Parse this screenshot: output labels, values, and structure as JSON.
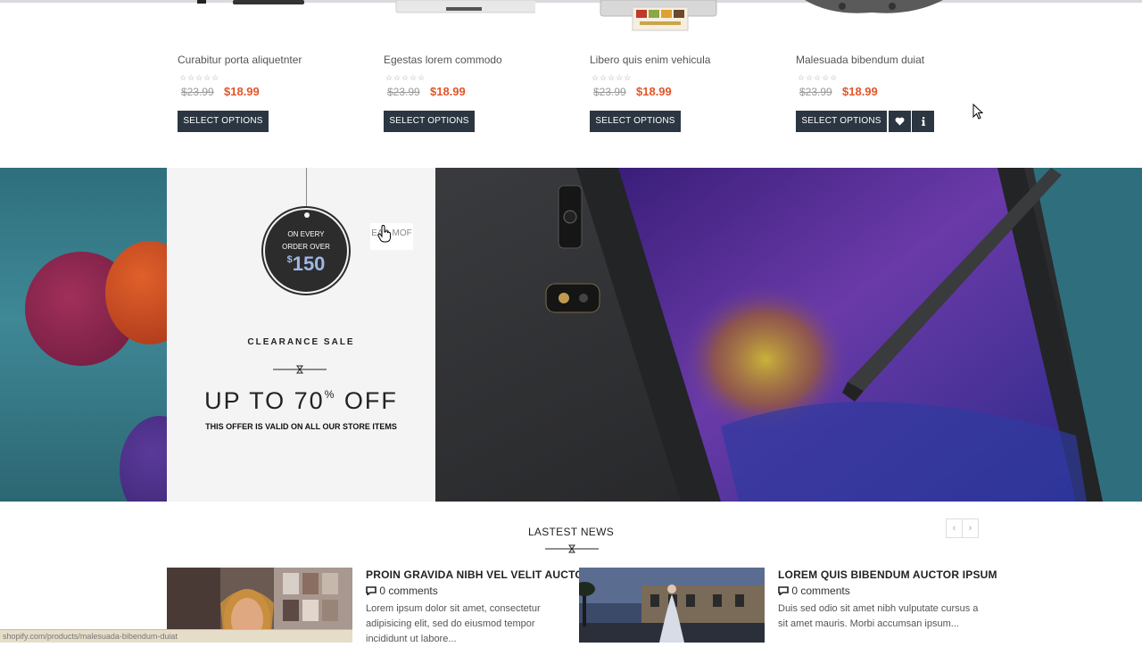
{
  "products": [
    {
      "name": "Curabitur porta aliquetnter",
      "stars": "☆☆☆☆☆",
      "old_price": "$23.99",
      "price": "$18.99",
      "button": "SELECT OPTIONS"
    },
    {
      "name": "Egestas lorem commodo",
      "stars": "☆☆☆☆☆",
      "old_price": "$23.99",
      "price": "$18.99",
      "button": "SELECT OPTIONS"
    },
    {
      "name": "Libero quis enim vehicula",
      "stars": "☆☆☆☆☆",
      "old_price": "$23.99",
      "price": "$18.99",
      "button": "SELECT OPTIONS"
    },
    {
      "name": "Malesuada bibendum duiat",
      "stars": "☆☆☆☆☆",
      "old_price": "$23.99",
      "price": "$18.99",
      "button": "SELECT OPTIONS",
      "wishlist_icon": "heart-icon",
      "info_icon": "info-icon"
    }
  ],
  "banner": {
    "tag_line1": "ON EVERY",
    "tag_line2": "ORDER OVER",
    "tag_currency": "$",
    "tag_amount": "150",
    "read_more": "EAD MOF",
    "clearance": "CLEARANCE SALE",
    "upto_prefix": "UP TO 70",
    "upto_percent": "%",
    "upto_suffix": " OFF",
    "valid": "THIS OFFER IS VALID ON ALL OUR STORE ITEMS"
  },
  "news": {
    "title": "LASTEST NEWS",
    "prev": "‹",
    "next": "›",
    "items": [
      {
        "title": "PROIN GRAVIDA NIBH VEL VELIT AUCTOR",
        "comments": "0 comments",
        "text": "Lorem ipsum dolor sit amet, consectetur adipisicing elit, sed do eiusmod tempor incididunt ut labore..."
      },
      {
        "title": "LOREM QUIS BIBENDUM AUCTOR IPSUM",
        "comments": "0 comments",
        "text": "Duis sed odio sit amet nibh vulputate cursus a sit amet mauris. Morbi accumsan ipsum..."
      }
    ]
  },
  "status_url": "shopify.com/products/malesuada-bibendum-duiat",
  "colors": {
    "button": "#2b3642",
    "price": "#e2552a",
    "panel": "#f4f4f4"
  }
}
